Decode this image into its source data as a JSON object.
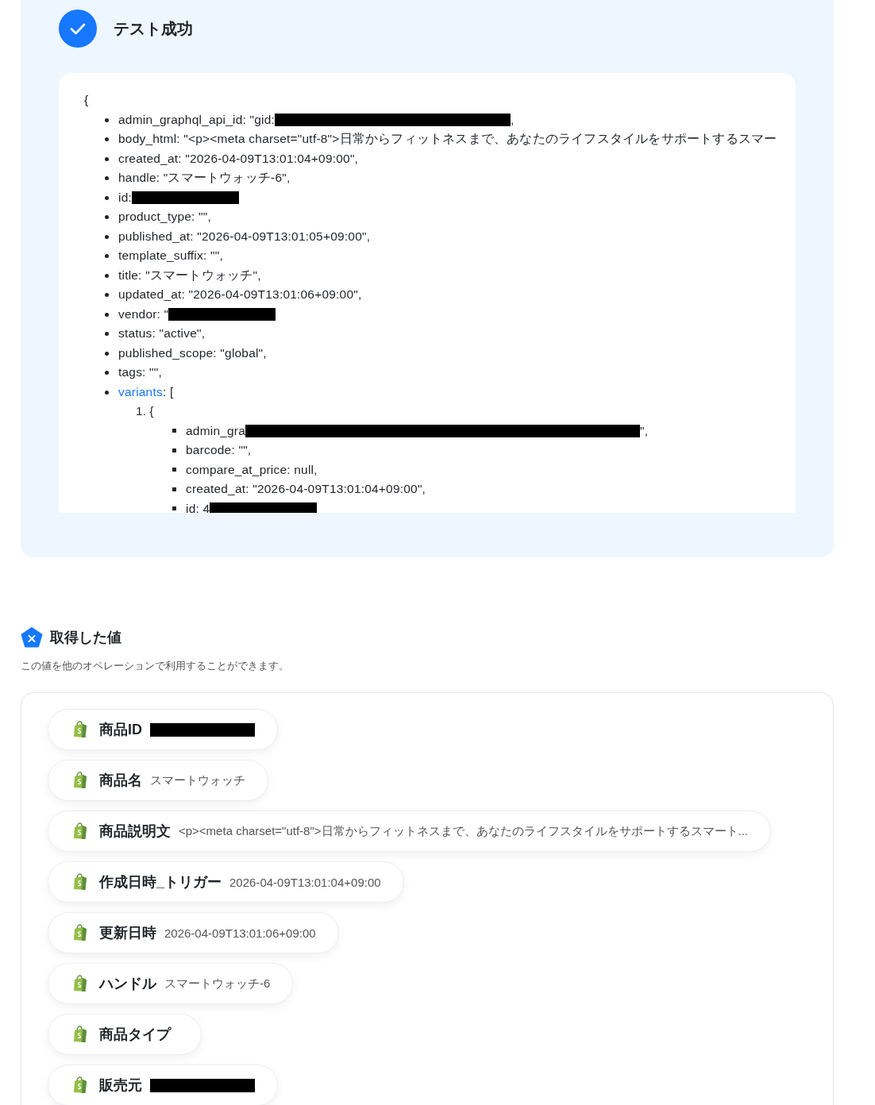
{
  "test_result": {
    "title": "テスト成功",
    "code": {
      "open": "{",
      "entries": [
        {
          "text": "admin_graphql_api_id: \"gid:",
          "redacted": true,
          "after": ","
        },
        {
          "text": "body_html: \"<p><meta charset=\"utf-8\">日常からフィットネスまで、あなたのライフスタイルをサポートするスマー"
        },
        {
          "text": "created_at: \"2026-04-09T13:01:04+09:00\","
        },
        {
          "text": "handle: \"スマートウォッチ-6\","
        },
        {
          "text": "id:",
          "redacted": true
        },
        {
          "text": "product_type: \"\","
        },
        {
          "text": "published_at: \"2026-04-09T13:01:05+09:00\","
        },
        {
          "text": "template_suffix: \"\","
        },
        {
          "text": "title: \"スマートウォッチ\","
        },
        {
          "text": "updated_at: \"2026-04-09T13:01:06+09:00\","
        },
        {
          "text": "vendor: \"",
          "redacted": true
        },
        {
          "text": "status: \"active\","
        },
        {
          "text": "published_scope: \"global\","
        },
        {
          "text": "tags: \"\","
        },
        {
          "link": "variants",
          "text": ": [",
          "children": [
            {
              "number": "1.",
              "text": "{",
              "children": [
                {
                  "text": "admin_gra",
                  "redacted": true,
                  "after": "\","
                },
                {
                  "text": "barcode: \"\","
                },
                {
                  "text": "compare_at_price: null,"
                },
                {
                  "text": "created_at: \"2026-04-09T13:01:04+09:00\","
                },
                {
                  "text": "id: 4",
                  "redacted": true
                }
              ]
            }
          ]
        }
      ]
    }
  },
  "values_section": {
    "title": "取得した値",
    "description": "この値を他のオペレーションで利用することができます。",
    "values": [
      {
        "label": "商品ID",
        "redacted": true
      },
      {
        "label": "商品名",
        "value": "スマートウォッチ"
      },
      {
        "label": "商品説明文",
        "value": "<p><meta charset=\"utf-8\">日常からフィットネスまで、あなたのライフスタイルをサポートするスマート..."
      },
      {
        "label": "作成日時_トリガー",
        "value": "2026-04-09T13:01:04+09:00"
      },
      {
        "label": "更新日時",
        "value": "2026-04-09T13:01:06+09:00"
      },
      {
        "label": "ハンドル",
        "value": "スマートウォッチ-6"
      },
      {
        "label": "商品タイプ"
      },
      {
        "label": "販売元",
        "redacted": true
      }
    ]
  }
}
